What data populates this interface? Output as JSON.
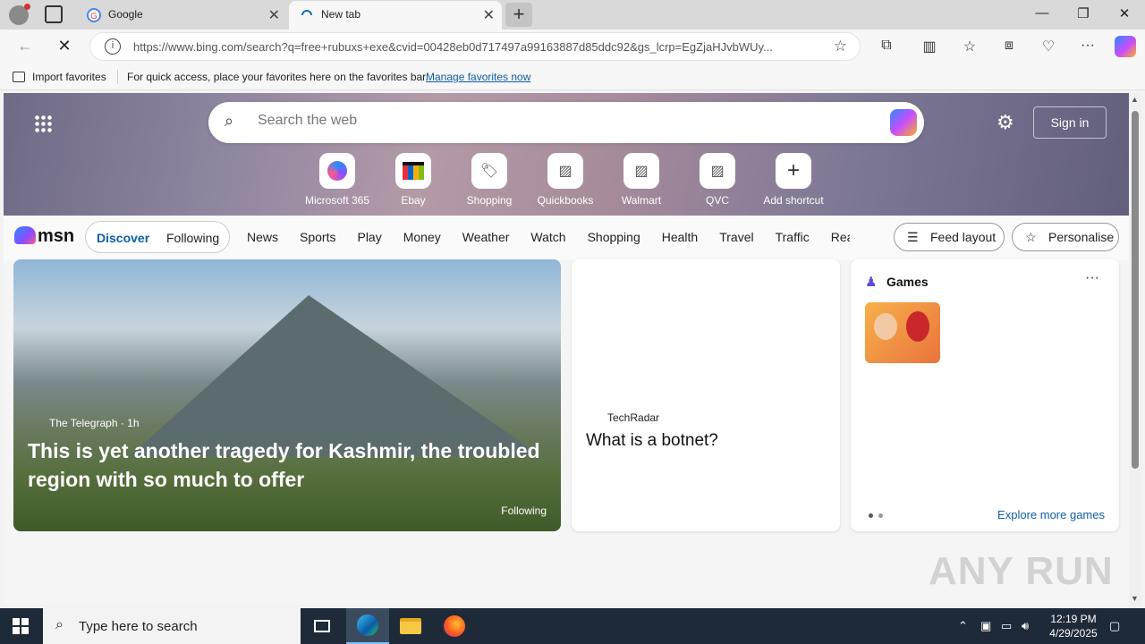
{
  "browser": {
    "tabs": [
      {
        "title": "Google"
      },
      {
        "title": "New tab"
      }
    ],
    "url": "https://www.bing.com/search?q=free+rubuxs+exe&cvid=00428eb0d717497a99163887d85ddc92&gs_lcrp=EgZjaHJvbWUy...",
    "favorites_bar": {
      "import_label": "Import favorites",
      "message": "For quick access, place your favorites here on the favorites bar.",
      "manage_link": "Manage favorites now"
    }
  },
  "newtab": {
    "search_placeholder": "Search the web",
    "sign_in": "Sign in",
    "shortcuts": [
      {
        "label": "Microsoft 365"
      },
      {
        "label": "Ebay"
      },
      {
        "label": "Shopping"
      },
      {
        "label": "Quickbooks"
      },
      {
        "label": "Walmart"
      },
      {
        "label": "QVC"
      },
      {
        "label": "Add shortcut"
      }
    ]
  },
  "msn": {
    "logo": "msn",
    "discover": "Discover",
    "following": "Following",
    "nav": [
      "News",
      "Sports",
      "Play",
      "Money",
      "Weather",
      "Watch",
      "Shopping",
      "Health",
      "Travel",
      "Traffic",
      "Real E"
    ],
    "feed_layout": "Feed layout",
    "personalise": "Personalise"
  },
  "cards": {
    "main": {
      "source": "The Telegraph · 1h",
      "headline": "This is yet another tragedy for Kashmir, the troubled region with so much to offer",
      "tag": "Following"
    },
    "mid": {
      "source": "TechRadar",
      "headline": "What is a botnet?"
    },
    "games": {
      "title": "Games",
      "explore": "Explore more games"
    }
  },
  "watermark": "ANY RUN",
  "taskbar": {
    "search_placeholder": "Type here to search",
    "time": "12:19 PM",
    "date": "4/29/2025"
  }
}
